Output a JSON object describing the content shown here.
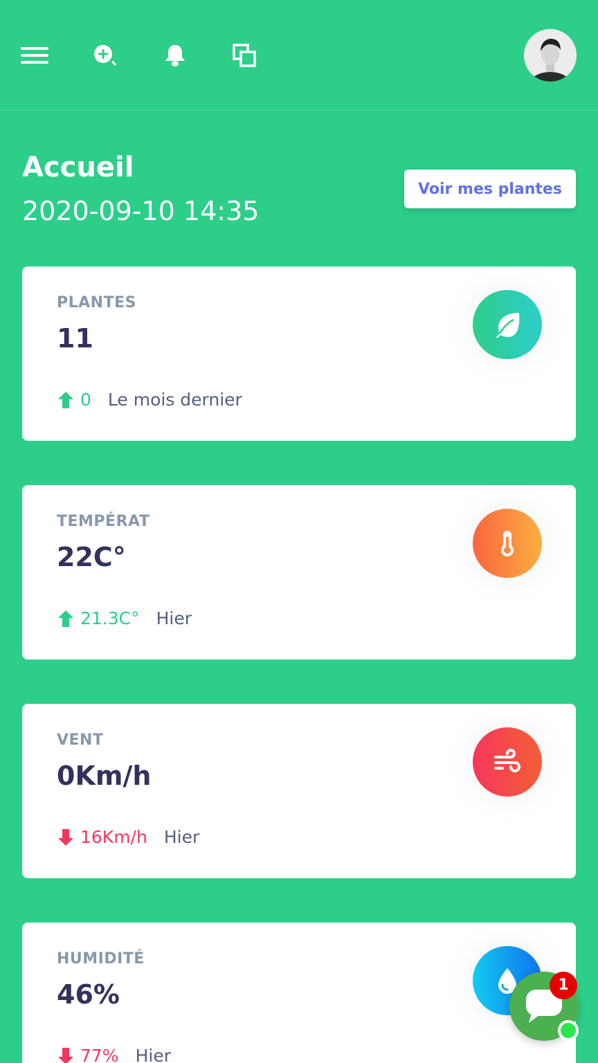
{
  "navbar": {
    "icons": [
      "hamburger-menu-icon",
      "zoom-in-icon",
      "bell-icon",
      "clone-icon"
    ],
    "avatar": "user-avatar"
  },
  "header": {
    "title": "Accueil",
    "datetime": "2020-09-10 14:35",
    "action_label": "Voir mes plantes"
  },
  "cards": [
    {
      "title": "PLANTES",
      "value": "11",
      "delta": "0",
      "trend": "up",
      "since": "Le mois dernier",
      "icon": "leaf-icon",
      "color": "#2dce89"
    },
    {
      "title": "TEMPÉRAT",
      "value": "22C°",
      "delta": "21.3C°",
      "trend": "up",
      "since": "Hier",
      "icon": "thermometer-icon",
      "color": "#fb6340"
    },
    {
      "title": "VENT",
      "value": "0Km/h",
      "delta": "16Km/h",
      "trend": "down",
      "since": "Hier",
      "icon": "wind-icon",
      "color": "#f5365c"
    },
    {
      "title": "HUMIDITÉ",
      "value": "46%",
      "delta": "77%",
      "trend": "down",
      "since": "Hier",
      "icon": "water-drop-icon",
      "color": "#11cdef"
    }
  ],
  "chat": {
    "badge_count": "1",
    "status": "online"
  },
  "colors": {
    "background": "#2dce89",
    "up": "#2dce89",
    "down": "#f5365c",
    "button_text": "#5e72e4"
  }
}
